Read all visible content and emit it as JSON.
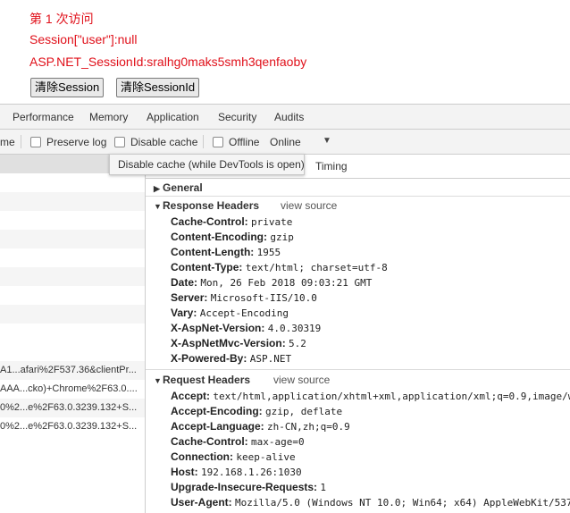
{
  "page": {
    "visit_text": "第 1 次访问",
    "session_user": "Session[\"user\"]:null",
    "session_id": "ASP.NET_SessionId:sralhg0maks5smh3qenfaoby",
    "btn_clear_session": "清除Session",
    "btn_clear_sessionid": "清除SessionId"
  },
  "devtools": {
    "tabs": [
      "Performance",
      "Memory",
      "Application",
      "Security",
      "Audits"
    ],
    "toolbar": {
      "name_fragment": "me",
      "preserve_log": "Preserve log",
      "disable_cache": "Disable cache",
      "offline": "Offline",
      "throttle": "Online"
    },
    "tooltip": "Disable cache (while DevTools is open)",
    "subtab_timing": "Timing",
    "requests": [
      "",
      "",
      "",
      "",
      "",
      "",
      "",
      "",
      "",
      "",
      "A1...afari%2F537.36&clientPr...",
      "AAA...cko)+Chrome%2F63.0....",
      "0%2...e%2F63.0.3239.132+S...",
      "0%2...e%2F63.0.3239.132+S..."
    ],
    "general_label": "General",
    "response_headers_label": "Response Headers",
    "request_headers_label": "Request Headers",
    "view_source": "view source",
    "response_headers": [
      {
        "k": "Cache-Control:",
        "v": "private"
      },
      {
        "k": "Content-Encoding:",
        "v": "gzip"
      },
      {
        "k": "Content-Length:",
        "v": "1955"
      },
      {
        "k": "Content-Type:",
        "v": "text/html; charset=utf-8"
      },
      {
        "k": "Date:",
        "v": "Mon, 26 Feb 2018 09:03:21 GMT"
      },
      {
        "k": "Server:",
        "v": "Microsoft-IIS/10.0"
      },
      {
        "k": "Vary:",
        "v": "Accept-Encoding"
      },
      {
        "k": "X-AspNet-Version:",
        "v": "4.0.30319"
      },
      {
        "k": "X-AspNetMvc-Version:",
        "v": "5.2"
      },
      {
        "k": "X-Powered-By:",
        "v": "ASP.NET"
      }
    ],
    "request_headers": [
      {
        "k": "Accept:",
        "v": "text/html,application/xhtml+xml,application/xml;q=0.9,image/w"
      },
      {
        "k": "Accept-Encoding:",
        "v": "gzip, deflate"
      },
      {
        "k": "Accept-Language:",
        "v": "zh-CN,zh;q=0.9"
      },
      {
        "k": "Cache-Control:",
        "v": "max-age=0"
      },
      {
        "k": "Connection:",
        "v": "keep-alive"
      },
      {
        "k": "Host:",
        "v": "192.168.1.26:1030"
      },
      {
        "k": "Upgrade-Insecure-Requests:",
        "v": "1"
      },
      {
        "k": "User-Agent:",
        "v": "Mozilla/5.0 (Windows NT 10.0; Win64; x64) AppleWebKit/537"
      }
    ]
  }
}
